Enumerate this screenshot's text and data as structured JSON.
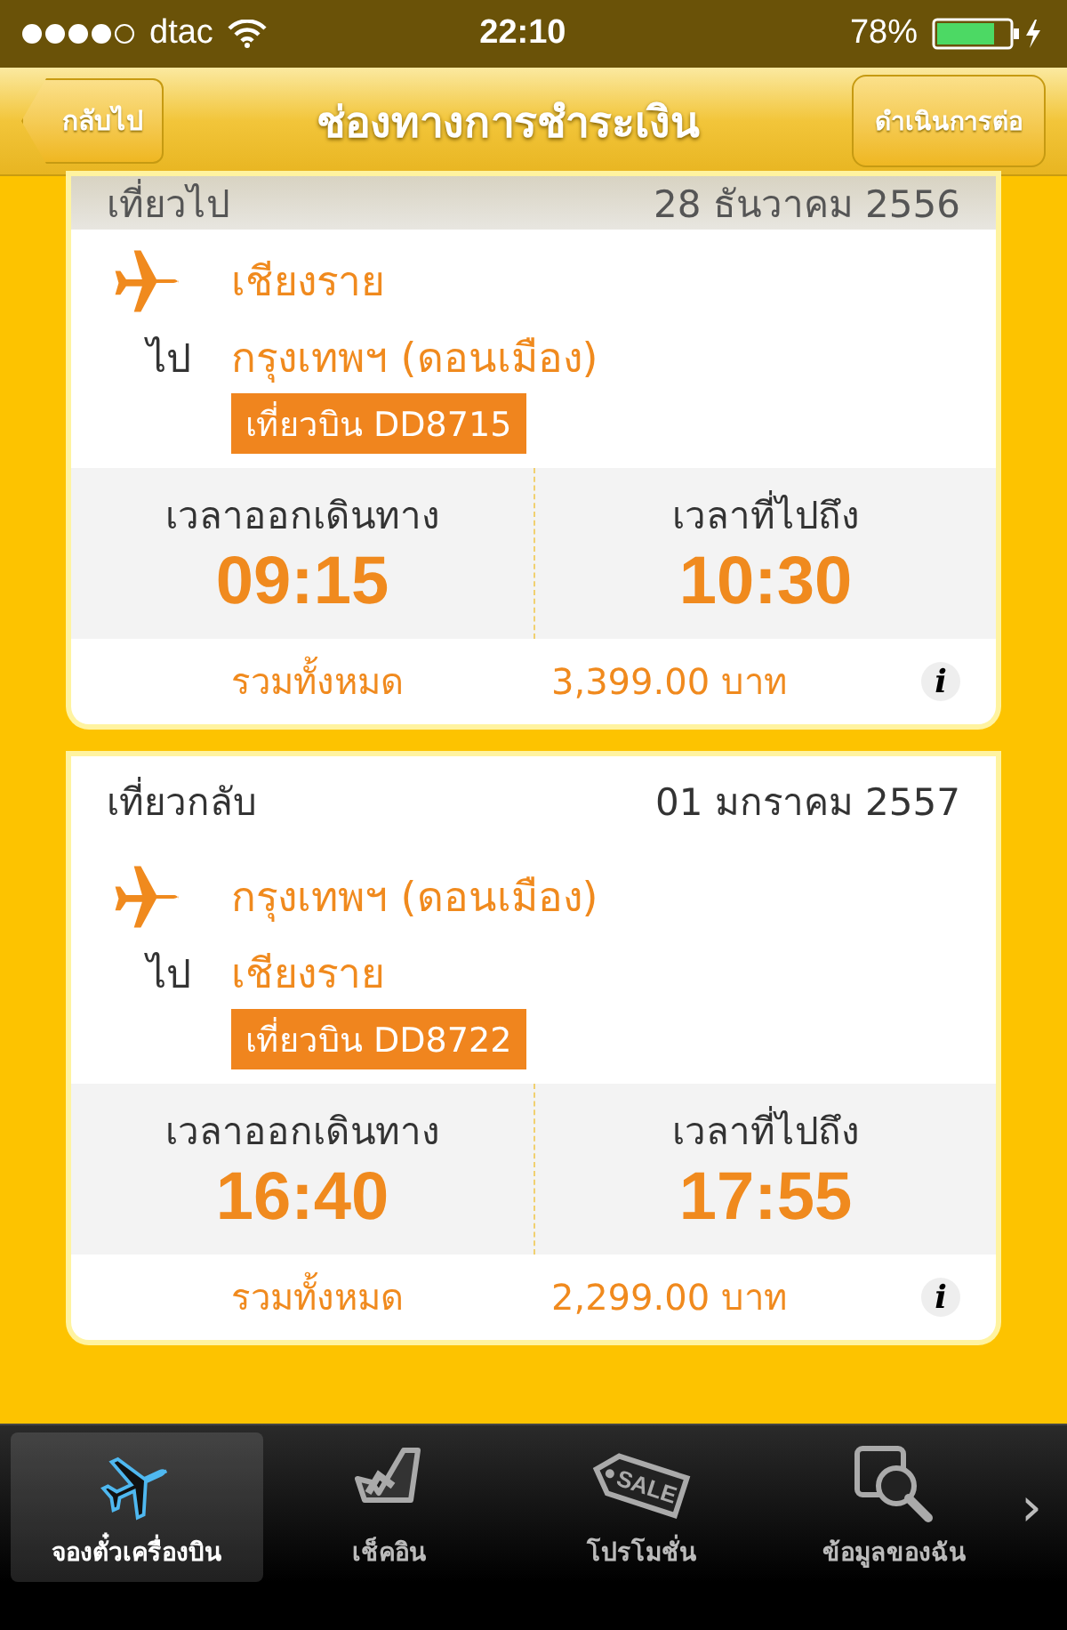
{
  "status_bar": {
    "carrier": "dtac",
    "time": "22:10",
    "battery": "78%"
  },
  "nav_bar": {
    "back": "กลับไป",
    "title": "ช่องทางการชำระเงิน",
    "action": "ดำเนินการต่อ"
  },
  "trips": [
    {
      "label": "เที่ยวไป",
      "date": "28 ธันวาคม 2556",
      "from": "เชียงราย",
      "to_word": "ไป",
      "to": "กรุงเทพฯ (ดอนเมือง)",
      "flight": "เที่ยวบิน DD8715",
      "departure_label": "เวลาออกเดินทาง",
      "departure": "09:15",
      "arrival_label": "เวลาที่ไปถึง",
      "arrival": "10:30",
      "total_label": "รวมทั้งหมด",
      "total": "3,399.00 บาท",
      "info": "i"
    },
    {
      "label": "เที่ยวกลับ",
      "date": "01 มกราคม 2557",
      "from": "กรุงเทพฯ (ดอนเมือง)",
      "to_word": "ไป",
      "to": "เชียงราย",
      "flight": "เที่ยวบิน DD8722",
      "departure_label": "เวลาออกเดินทาง",
      "departure": "16:40",
      "arrival_label": "เวลาที่ไปถึง",
      "arrival": "17:55",
      "total_label": "รวมทั้งหมด",
      "total": "2,299.00 บาท",
      "info": "i"
    }
  ],
  "tab_bar": {
    "tabs": [
      {
        "kind": "plane",
        "label": "จองตั๋วเครื่องบิน",
        "selected": true
      },
      {
        "kind": "seat",
        "label": "เช็คอิน",
        "selected": false
      },
      {
        "kind": "tag",
        "label": "โปรโมชั่น",
        "icon_text": "SALE",
        "selected": false
      },
      {
        "kind": "search",
        "label": "ข้อมูลของฉัน",
        "selected": false
      }
    ],
    "more": "›"
  }
}
